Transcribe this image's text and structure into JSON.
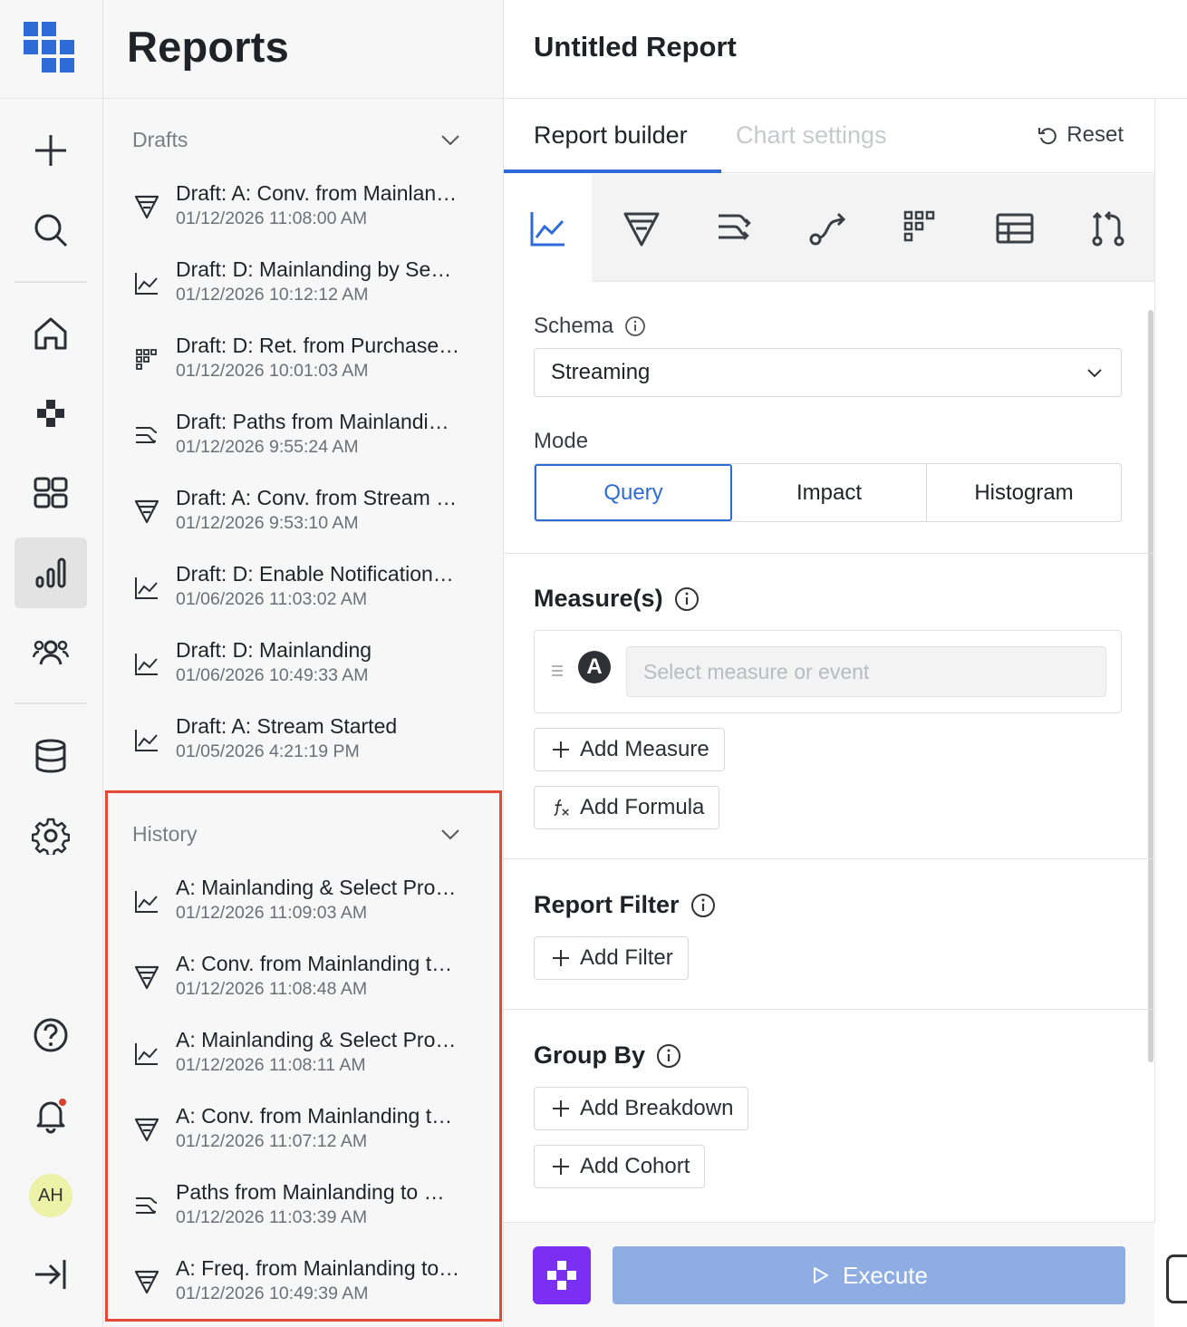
{
  "rail": {
    "items": [
      "new",
      "search",
      "home",
      "explore",
      "dashboards",
      "reports",
      "users",
      "data",
      "settings",
      "help",
      "notifications",
      "collapse"
    ],
    "active": "reports",
    "avatar_initials": "AH",
    "notification_dot_color": "#d9412e"
  },
  "panel": {
    "title": "Reports",
    "drafts": {
      "label": "Drafts",
      "items": [
        {
          "icon": "funnel-icon",
          "title": "Draft: A: Conv. from Mainlan…",
          "date": "01/12/2026 11:08:00 AM"
        },
        {
          "icon": "line-chart-icon",
          "title": "Draft: D: Mainlanding by Se…",
          "date": "01/12/2026 10:12:12 AM"
        },
        {
          "icon": "retention-grid-icon",
          "title": "Draft: D: Ret. from Purchase…",
          "date": "01/12/2026 10:01:03 AM"
        },
        {
          "icon": "paths-icon",
          "title": "Draft: Paths from Mainlandi…",
          "date": "01/12/2026 9:55:24 AM"
        },
        {
          "icon": "funnel-icon",
          "title": "Draft: A: Conv. from Stream …",
          "date": "01/12/2026 9:53:10 AM"
        },
        {
          "icon": "line-chart-icon",
          "title": "Draft: D: Enable Notification…",
          "date": "01/06/2026 11:03:02 AM"
        },
        {
          "icon": "line-chart-icon",
          "title": "Draft: D: Mainlanding",
          "date": "01/06/2026 10:49:33 AM"
        },
        {
          "icon": "line-chart-icon",
          "title": "Draft: A: Stream Started",
          "date": "01/05/2026 4:21:19 PM"
        }
      ]
    },
    "history": {
      "label": "History",
      "highlight_color": "#e34a36",
      "items": [
        {
          "icon": "line-chart-icon",
          "title": "A: Mainlanding & Select Pro…",
          "date": "01/12/2026 11:09:03 AM"
        },
        {
          "icon": "funnel-icon",
          "title": "A: Conv. from Mainlanding t…",
          "date": "01/12/2026 11:08:48 AM"
        },
        {
          "icon": "line-chart-icon",
          "title": "A: Mainlanding & Select Pro…",
          "date": "01/12/2026 11:08:11 AM"
        },
        {
          "icon": "funnel-icon",
          "title": "A: Conv. from Mainlanding t…",
          "date": "01/12/2026 11:07:12 AM"
        },
        {
          "icon": "paths-icon",
          "title": "Paths from Mainlanding to …",
          "date": "01/12/2026 11:03:39 AM"
        },
        {
          "icon": "funnel-icon",
          "title": "A: Freq. from Mainlanding to…",
          "date": "01/12/2026 10:49:39 AM"
        }
      ]
    }
  },
  "main": {
    "title": "Untitled Report",
    "tabs": [
      {
        "label": "Report builder",
        "active": true
      },
      {
        "label": "Chart settings",
        "active": false
      }
    ],
    "reset_label": "Reset",
    "report_types": [
      "line-chart-icon",
      "funnel-icon",
      "paths-icon",
      "flow-icon",
      "retention-grid-icon",
      "table-icon",
      "compare-icon"
    ],
    "active_type": "line-chart-icon",
    "schema": {
      "label": "Schema",
      "value": "Streaming"
    },
    "mode": {
      "label": "Mode",
      "options": [
        "Query",
        "Impact",
        "Histogram"
      ],
      "selected": "Query"
    },
    "measures": {
      "label": "Measure(s)",
      "badge": "A",
      "placeholder": "Select measure or event",
      "add_measure": "Add Measure",
      "add_formula": "Add Formula"
    },
    "report_filter": {
      "label": "Report Filter",
      "add_filter": "Add Filter"
    },
    "group_by": {
      "label": "Group By",
      "add_breakdown": "Add Breakdown",
      "add_cohort": "Add Cohort"
    },
    "execute_label": "Execute",
    "accent_color": "#2f6bd6",
    "execute_color": "#8eaee3",
    "ai_button_color": "#7b2ff2"
  }
}
